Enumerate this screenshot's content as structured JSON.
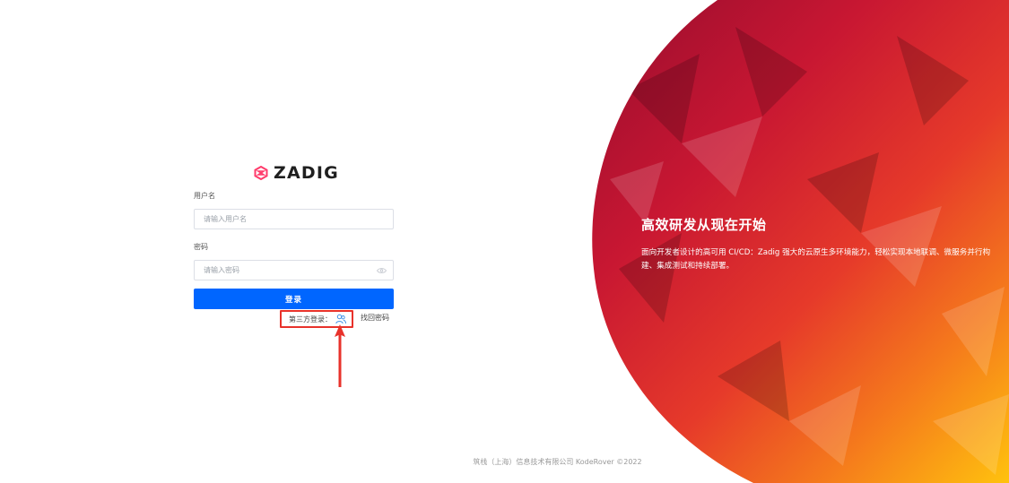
{
  "brand": {
    "name": "ZADIG"
  },
  "form": {
    "username_label": "用户名",
    "username_placeholder": "请输入用户名",
    "password_label": "密码",
    "password_placeholder": "请输入密码",
    "login_label": "登录",
    "third_party_label": "第三方登录：",
    "forgot_label": "找回密码"
  },
  "hero": {
    "title": "高效研发从现在开始",
    "description": "面向开发者设计的高可用 CI/CD：Zadig 强大的云原生多环境能力，轻松实现本地联调、微服务并行构建、集成测试和持续部署。"
  },
  "footer": {
    "copyright": "筑栈（上海）信息技术有限公司 KodeRover ©2022"
  },
  "colors": {
    "primary": "#0066ff",
    "highlight": "#e8322b",
    "logo_accent": "#ff3b6b"
  },
  "icons": {
    "logo": "zadig-logo-icon",
    "eye": "eye-icon",
    "sso": "sso-user-icon",
    "arrow": "annotation-arrow"
  }
}
